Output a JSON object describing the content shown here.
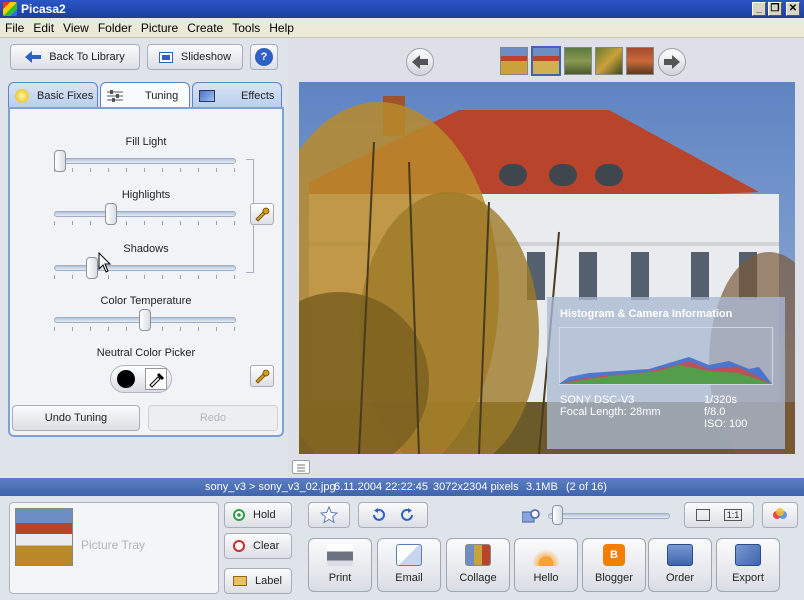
{
  "window": {
    "title": "Picasa2",
    "controls": [
      "_",
      "❐",
      "✕"
    ]
  },
  "menu": [
    "File",
    "Edit",
    "View",
    "Folder",
    "Picture",
    "Create",
    "Tools",
    "Help"
  ],
  "toolbar": {
    "back_label": "Back To Library",
    "slideshow_label": "Slideshow",
    "help_label": "?"
  },
  "tabs": [
    "Basic Fixes",
    "Tuning",
    "Effects"
  ],
  "tuning": {
    "fill_light": {
      "label": "Fill Light",
      "value": 0.0
    },
    "highlights": {
      "label": "Highlights",
      "value": 0.3
    },
    "shadows": {
      "label": "Shadows",
      "value": 0.19
    },
    "color_temperature": {
      "label": "Color Temperature",
      "value": 0.5
    },
    "neutral_picker_label": "Neutral Color Picker",
    "undo_label": "Undo Tuning",
    "redo_label": "Redo"
  },
  "histogram": {
    "title": "Histogram & Camera Information",
    "camera": "SONY DSC-V3",
    "focal_label": "Focal Length:",
    "focal_value": "28mm",
    "shutter": "1/320s",
    "aperture": "f/8.0",
    "iso": "ISO: 100"
  },
  "status": {
    "path": "sony_v3 > sony_v3_02.jpg",
    "datetime": "6.11.2004 22:22:45",
    "dimensions": "3072x2304 pixels",
    "size": "3.1MB",
    "position": "(2 of 16)"
  },
  "tray": {
    "label": "Picture Tray",
    "hold": "Hold",
    "clear": "Clear",
    "label_btn": "Label"
  },
  "view_modes": [
    "",
    "1:1"
  ],
  "zoom_level": 0.0,
  "actions": [
    "Print",
    "Email",
    "Collage",
    "Hello",
    "Blogger",
    "Order",
    "Export"
  ],
  "colors": {
    "accent": "#3f63ad",
    "tab_border": "#7ea1d8",
    "roof": "#b8452b",
    "sky": "#6d8ec4"
  }
}
